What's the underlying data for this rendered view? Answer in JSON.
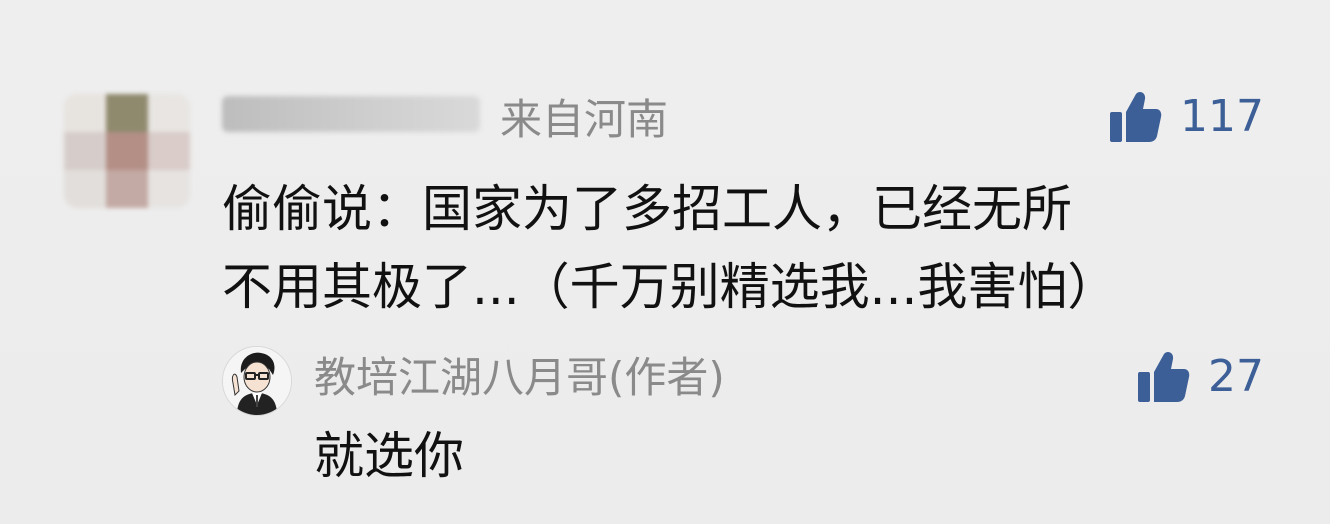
{
  "comment": {
    "location": "来自河南",
    "likes": "117",
    "text_line1": "偷偷说：国家为了多招工人，已经无所",
    "text_line2": "不用其极了...（千万别精选我...我害怕）"
  },
  "reply": {
    "author": "教培江湖八月哥(作者)",
    "likes": "27",
    "text": "就选你"
  },
  "colors": {
    "background": "#ededed",
    "accent_blue": "#3d5f97",
    "meta_gray": "#8a8a8a"
  },
  "icons": [
    "thumbs-up-icon"
  ]
}
